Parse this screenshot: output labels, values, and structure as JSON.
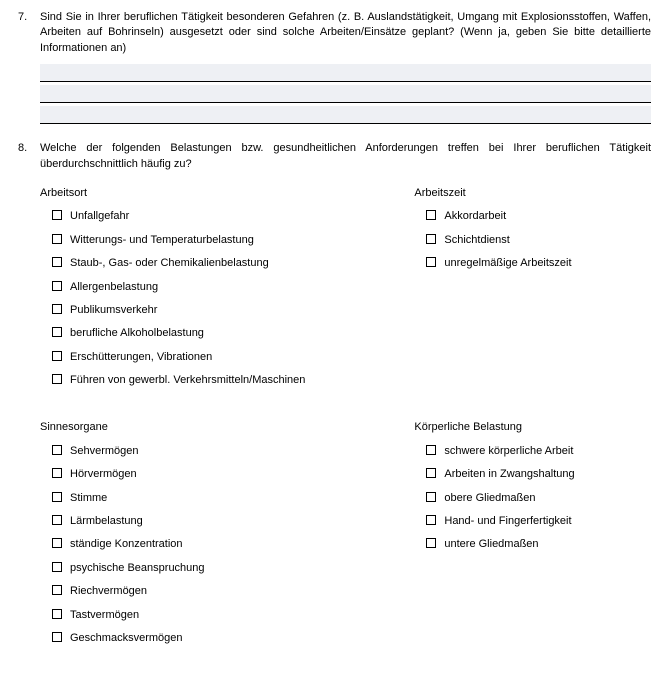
{
  "q7": {
    "number": "7.",
    "text": "Sind Sie in Ihrer beruflichen Tätigkeit besonderen Gefahren (z. B. Auslandstätigkeit, Umgang mit Explosionsstoffen, Waffen, Arbeiten auf Bohrinseln) ausgesetzt oder sind solche Arbeiten/Einsätze geplant? (Wenn ja, geben Sie bitte detaillierte Informationen an)"
  },
  "q8": {
    "number": "8.",
    "text": "Welche der folgenden Belastungen bzw. gesundheitlichen Anforderungen treffen bei Ihrer beruflichen Tätigkeit überdurchschnittlich häufig zu?",
    "arbeitsort": {
      "title": "Arbeitsort",
      "items": [
        "Unfallgefahr",
        "Witterungs- und Temperaturbelastung",
        "Staub-, Gas- oder Chemikalienbelastung",
        "Allergenbelastung",
        "Publikumsverkehr",
        "berufliche Alkoholbelastung",
        "Erschütterungen, Vibrationen",
        "Führen von gewerbl. Verkehrsmitteln/Maschinen"
      ]
    },
    "arbeitszeit": {
      "title": "Arbeitszeit",
      "items": [
        "Akkordarbeit",
        "Schichtdienst",
        "unregelmäßige Arbeitszeit"
      ]
    },
    "sinnesorgane": {
      "title": "Sinnesorgane",
      "items": [
        "Sehvermögen",
        "Hörvermögen",
        "Stimme",
        "Lärmbelastung",
        "ständige Konzentration",
        "psychische Beanspruchung",
        "Riechvermögen",
        "Tastvermögen",
        "Geschmacksvermögen"
      ]
    },
    "koerperlich": {
      "title": "Körperliche Belastung",
      "items": [
        "schwere körperliche Arbeit",
        "Arbeiten in Zwangshaltung",
        "obere Gliedmaßen",
        "Hand- und Fingerfertigkeit",
        "untere Gliedmaßen"
      ]
    }
  }
}
